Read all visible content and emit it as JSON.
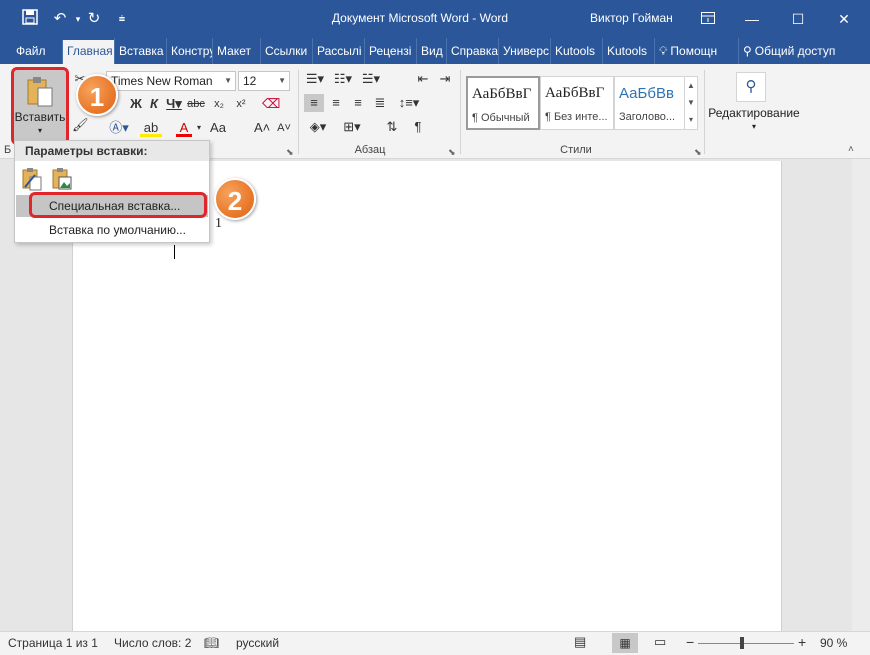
{
  "titlebar": {
    "doc_title": "Документ Microsoft Word  -  Word",
    "user": "Виктор Гойман"
  },
  "tabs": [
    "Файл",
    "Главная",
    "Вставка",
    "Констру",
    "Макет",
    "Ссылки",
    "Рассылі",
    "Рецензі",
    "Вид",
    "Справка",
    "Универс",
    "Kutools",
    "Kutools",
    "Помощн",
    "Общий доступ"
  ],
  "ribbon": {
    "paste_label": "Вставить",
    "font_name": "Times New Roman",
    "font_size": "12",
    "group_clipboard": "Б",
    "group_paragraph": "Абзац",
    "group_styles": "Стили",
    "group_editing": "Редактирование",
    "styles": [
      {
        "preview": "АаБбВвГ",
        "name": "¶ Обычный"
      },
      {
        "preview": "АаБбВвГ",
        "name": "¶ Без инте..."
      },
      {
        "preview": "АаБбВв",
        "name": "Заголово..."
      }
    ]
  },
  "paste_menu": {
    "header": "Параметры вставки:",
    "special": "Специальная вставка...",
    "default": "Вставка по умолчанию..."
  },
  "document": {
    "visible_text": "1"
  },
  "callouts": [
    "1",
    "2"
  ],
  "statusbar": {
    "page": "Страница 1 из 1",
    "words": "Число слов: 2",
    "language": "русский",
    "zoom": "90 %"
  },
  "colors": {
    "title_blue": "#2b579a",
    "callout_orange": "#e8741c",
    "highlight_red": "#e0262b"
  }
}
